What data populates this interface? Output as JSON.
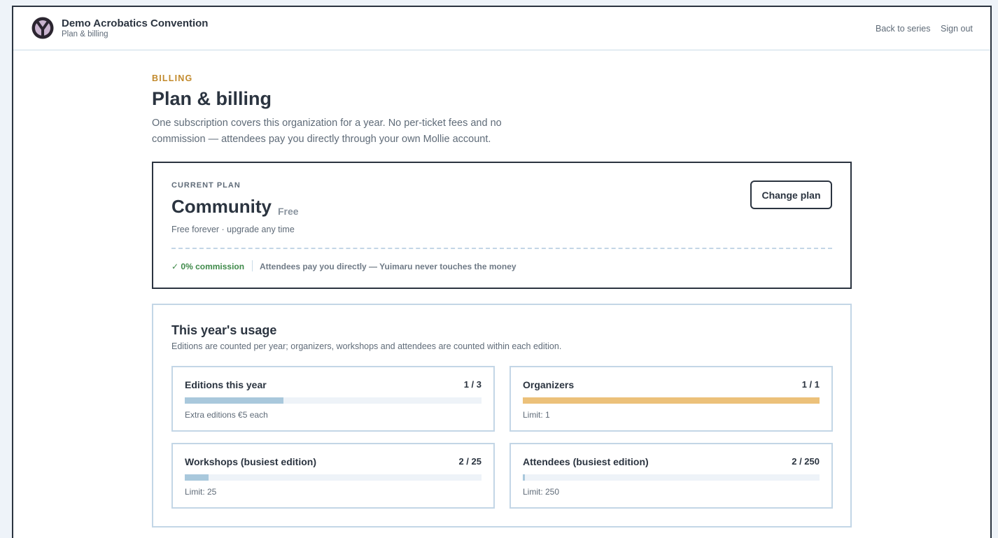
{
  "header": {
    "org_name": "Demo Acrobatics Convention",
    "section": "Plan & billing",
    "links": {
      "back": "Back to series",
      "signout": "Sign out"
    }
  },
  "main": {
    "eyebrow": "BILLING",
    "title": "Plan & billing",
    "intro": "One subscription covers this organization for a year. No per-ticket fees and no commission — attendees pay you directly through your own Mollie account."
  },
  "plan": {
    "eyebrow": "CURRENT PLAN",
    "name": "Community",
    "price": "Free",
    "note": "Free forever · upgrade any time",
    "change_label": "Change plan",
    "commission": "✓ 0% commission",
    "commission_note": "Attendees pay you directly — Yuimaru never touches the money"
  },
  "usage": {
    "title": "This year's usage",
    "subtitle": "Editions are counted per year; organizers, workshops and attendees are counted within each edition.",
    "metrics": [
      {
        "label": "Editions this year",
        "count": "1 / 3",
        "used": 1,
        "limit": 3,
        "note": "Extra editions €5 each"
      },
      {
        "label": "Organizers",
        "count": "1 / 1",
        "used": 1,
        "limit": 1,
        "note": "Limit: 1"
      },
      {
        "label": "Workshops (busiest edition)",
        "count": "2 / 25",
        "used": 2,
        "limit": 25,
        "note": "Limit: 25"
      },
      {
        "label": "Attendees (busiest edition)",
        "count": "2 / 250",
        "used": 2,
        "limit": 250,
        "note": "Limit: 250"
      }
    ]
  },
  "colors": {
    "accent": "#c28a2c",
    "bar_normal": "#a9c8dc",
    "bar_full": "#ecc17a",
    "success": "#3f8a4a",
    "ink": "#2b3440"
  }
}
